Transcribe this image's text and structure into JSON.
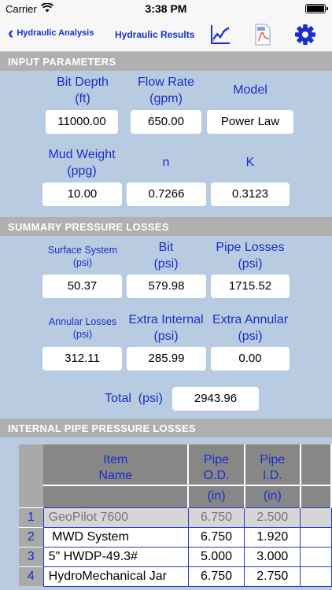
{
  "status_bar": {
    "carrier": "Carrier",
    "time": "3:38 PM"
  },
  "nav": {
    "back_label": "Hydraulic Analysis",
    "title": "Hydraulic Results"
  },
  "sections": {
    "input": "INPUT PARAMETERS",
    "summary": "SUMMARY PRESSURE LOSSES",
    "internal": "INTERNAL PIPE PRESSURE LOSSES"
  },
  "input": {
    "bit_depth": {
      "label1": "Bit Depth",
      "label2": "(ft)",
      "value": "11000.00"
    },
    "flow_rate": {
      "label1": "Flow Rate",
      "label2": "(gpm)",
      "value": "650.00"
    },
    "model": {
      "label": "Model",
      "value": "Power Law"
    },
    "mud_weight": {
      "label1": "Mud Weight",
      "label2": "(ppg)",
      "value": "10.00"
    },
    "n": {
      "label": "n",
      "value": "0.7266"
    },
    "k": {
      "label": "K",
      "value": "0.3123"
    }
  },
  "summary": {
    "surface": {
      "label1": "Surface System",
      "label2": "(psi)",
      "value": "50.37"
    },
    "bit": {
      "label1": "Bit",
      "label2": "(psi)",
      "value": "579.98"
    },
    "pipe": {
      "label1": "Pipe Losses",
      "label2": "(psi)",
      "value": "1715.52"
    },
    "annular": {
      "label1": "Annular Losses",
      "label2": "(psi)",
      "value": "312.11"
    },
    "extra_internal": {
      "label1": "Extra Internal",
      "label2": "(psi)",
      "value": "285.99"
    },
    "extra_annular": {
      "label1": "Extra Annular",
      "label2": "(psi)",
      "value": "0.00"
    },
    "total": {
      "label": "Total  (psi)",
      "value": "2943.96"
    }
  },
  "table": {
    "headers": {
      "item": {
        "line1": "Item",
        "line2": "Name"
      },
      "od": {
        "line1": "Pipe",
        "line2": "O.D.",
        "unit": "(in)"
      },
      "id": {
        "line1": "Pipe",
        "line2": "I.D.",
        "unit": "(in)"
      }
    },
    "rows": [
      {
        "num": "1",
        "name": "GeoPilot 7600",
        "od": "6.750",
        "id": "2.500"
      },
      {
        "num": "2",
        "name": " MWD System",
        "od": "6.750",
        "id": "1.920"
      },
      {
        "num": "3",
        "name": "5\" HWDP-49.3#",
        "od": "5.000",
        "id": "3.000"
      },
      {
        "num": "4",
        "name": "HydroMechanical Jar",
        "od": "6.750",
        "id": "2.750"
      }
    ]
  }
}
